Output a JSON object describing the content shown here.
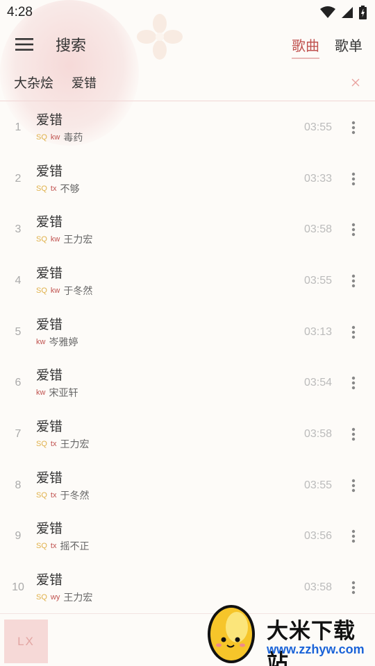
{
  "status": {
    "time": "4:28"
  },
  "header": {
    "title": "搜索",
    "tabs": [
      {
        "label": "歌曲",
        "active": true
      },
      {
        "label": "歌单",
        "active": false
      }
    ]
  },
  "search": {
    "source": "大杂烩",
    "query": "爱错"
  },
  "colors": {
    "accent": "#c0524f",
    "sq_tag": "#e0b14a"
  },
  "songs": [
    {
      "index": "1",
      "title": "爱错",
      "sq": "SQ",
      "source": "kw",
      "artist": "毒药",
      "duration": "03:55"
    },
    {
      "index": "2",
      "title": "爱错",
      "sq": "SQ",
      "source": "tx",
      "artist": "不够",
      "duration": "03:33"
    },
    {
      "index": "3",
      "title": "爱错",
      "sq": "SQ",
      "source": "kw",
      "artist": "王力宏",
      "duration": "03:58"
    },
    {
      "index": "4",
      "title": "爱错",
      "sq": "SQ",
      "source": "kw",
      "artist": "于冬然",
      "duration": "03:55"
    },
    {
      "index": "5",
      "title": "爱错",
      "sq": "",
      "source": "kw",
      "artist": "岑雅婷",
      "duration": "03:13"
    },
    {
      "index": "6",
      "title": "爱错",
      "sq": "",
      "source": "kw",
      "artist": "宋亚轩",
      "duration": "03:54"
    },
    {
      "index": "7",
      "title": "爱错",
      "sq": "SQ",
      "source": "tx",
      "artist": "王力宏",
      "duration": "03:58"
    },
    {
      "index": "8",
      "title": "爱错",
      "sq": "SQ",
      "source": "tx",
      "artist": "于冬然",
      "duration": "03:55"
    },
    {
      "index": "9",
      "title": "爱错",
      "sq": "SQ",
      "source": "tx",
      "artist": "摇不正",
      "duration": "03:56"
    },
    {
      "index": "10",
      "title": "爱错",
      "sq": "SQ",
      "source": "wy",
      "artist": "王力宏",
      "duration": "03:58"
    }
  ],
  "player": {
    "logo": "LX"
  },
  "watermark": {
    "text": "大米下载站",
    "url": "www.zzhyw.com"
  }
}
